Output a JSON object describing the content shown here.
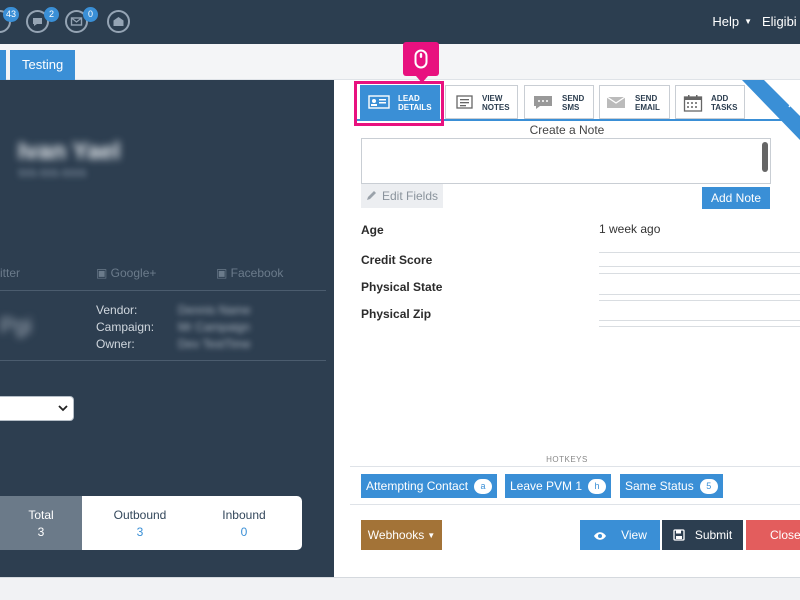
{
  "topbar": {
    "badges": {
      "count_1": "43",
      "count_2": "2",
      "count_3": "0"
    },
    "help_label": "Help",
    "right_text": "Eligibi"
  },
  "tabs": {
    "active_label": "Testing"
  },
  "left_panel": {
    "social": {
      "twitter": "itter",
      "google": "Google+",
      "facebook": "Facebook"
    },
    "meta": {
      "vendor_label": "Vendor:",
      "campaign_label": "Campaign:",
      "owner_label": "Owner:"
    },
    "stats": {
      "total": {
        "label": "Total",
        "value": "3"
      },
      "outbound": {
        "label": "Outbound",
        "value": "3"
      },
      "inbound": {
        "label": "Inbound",
        "value": "0"
      }
    }
  },
  "action_tabs": [
    {
      "line1": "LEAD",
      "line2": "DETAILS",
      "icon": "id-card-icon"
    },
    {
      "line1": "VIEW",
      "line2": "NOTES",
      "icon": "notes-icon"
    },
    {
      "line1": "SEND",
      "line2": "SMS",
      "icon": "sms-icon"
    },
    {
      "line1": "SEND",
      "line2": "EMAIL",
      "icon": "envelope-icon"
    },
    {
      "line1": "ADD",
      "line2": "TASKS",
      "icon": "calendar-icon"
    }
  ],
  "note": {
    "title": "Create a Note",
    "edit_fields_label": "Edit Fields",
    "add_button_label": "Add Note"
  },
  "fields": [
    {
      "label": "Age",
      "value": "1 week ago"
    },
    {
      "label": "Credit Score",
      "value": ""
    },
    {
      "label": "Physical State",
      "value": ""
    },
    {
      "label": "Physical Zip",
      "value": ""
    }
  ],
  "hotkeys": {
    "label": "HOTKEYS",
    "items": [
      {
        "label": "Attempting Contact",
        "key": "a"
      },
      {
        "label": "Leave PVM 1",
        "key": "h"
      },
      {
        "label": "Same Status",
        "key": "5"
      }
    ]
  },
  "actions": {
    "webhooks_label": "Webhooks",
    "view_label": "View",
    "submit_label": "Submit",
    "close_label": "Close"
  },
  "colors": {
    "navy": "#2c3e50",
    "accent_blue": "#3a8fd6",
    "highlight_pink": "#e8117f",
    "webhooks_brown": "#a37337",
    "close_red": "#e35d5d"
  }
}
